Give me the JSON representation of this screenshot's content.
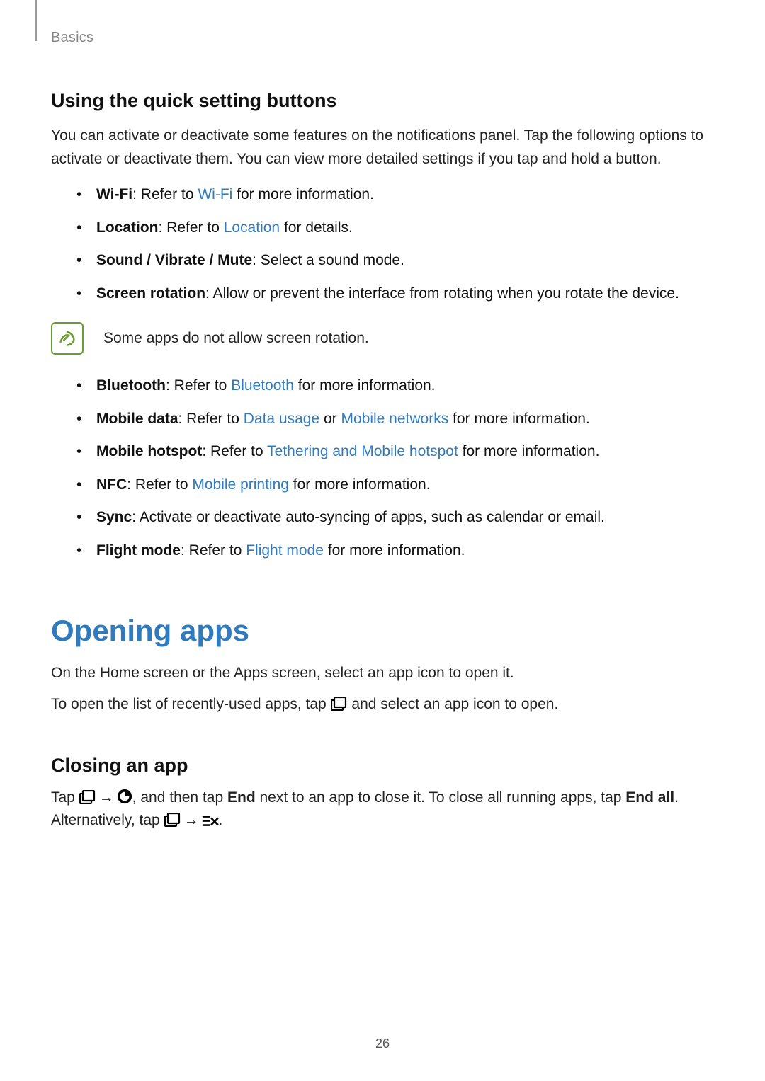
{
  "breadcrumb": "Basics",
  "section_quick": {
    "heading": "Using the quick setting buttons",
    "intro": "You can activate or deactivate some features on the notifications panel. Tap the following options to activate or deactivate them. You can view more detailed settings if you tap and hold a button.",
    "items_a": [
      {
        "bold": "Wi-Fi",
        "pre": ": Refer to ",
        "link": "Wi-Fi",
        "post": " for more information."
      },
      {
        "bold": "Location",
        "pre": ": Refer to ",
        "link": "Location",
        "post": " for details."
      },
      {
        "bold": "Sound / Vibrate / Mute",
        "pre": ": Select a sound mode."
      },
      {
        "bold": "Screen rotation",
        "pre": ": Allow or prevent the interface from rotating when you rotate the device."
      }
    ],
    "note": "Some apps do not allow screen rotation.",
    "items_b": [
      {
        "bold": "Bluetooth",
        "pre": ": Refer to ",
        "link": "Bluetooth",
        "post": " for more information."
      },
      {
        "bold": "Mobile data",
        "pre": ": Refer to ",
        "link": "Data usage",
        "mid": " or ",
        "link2": "Mobile networks",
        "post": " for more information."
      },
      {
        "bold": "Mobile hotspot",
        "pre": ": Refer to ",
        "link": "Tethering and Mobile hotspot",
        "post": " for more information."
      },
      {
        "bold": "NFC",
        "pre": ": Refer to ",
        "link": "Mobile printing",
        "post": " for more information."
      },
      {
        "bold": "Sync",
        "pre": ": Activate or deactivate auto-syncing of apps, such as calendar or email."
      },
      {
        "bold": "Flight mode",
        "pre": ": Refer to ",
        "link": "Flight mode",
        "post": " for more information."
      }
    ]
  },
  "section_opening": {
    "title": "Opening apps",
    "p1": "On the Home screen or the Apps screen, select an app icon to open it.",
    "p2_a": "To open the list of recently-used apps, tap ",
    "p2_b": " and select an app icon to open.",
    "closing_heading": "Closing an app",
    "close_a": "Tap ",
    "arrow": "→",
    "close_b": ", and then tap ",
    "end": "End",
    "close_c": " next to an app to close it. To close all running apps, tap ",
    "end_all": "End all",
    "close_d": ". Alternatively, tap ",
    "close_e": "."
  },
  "page_number": "26"
}
